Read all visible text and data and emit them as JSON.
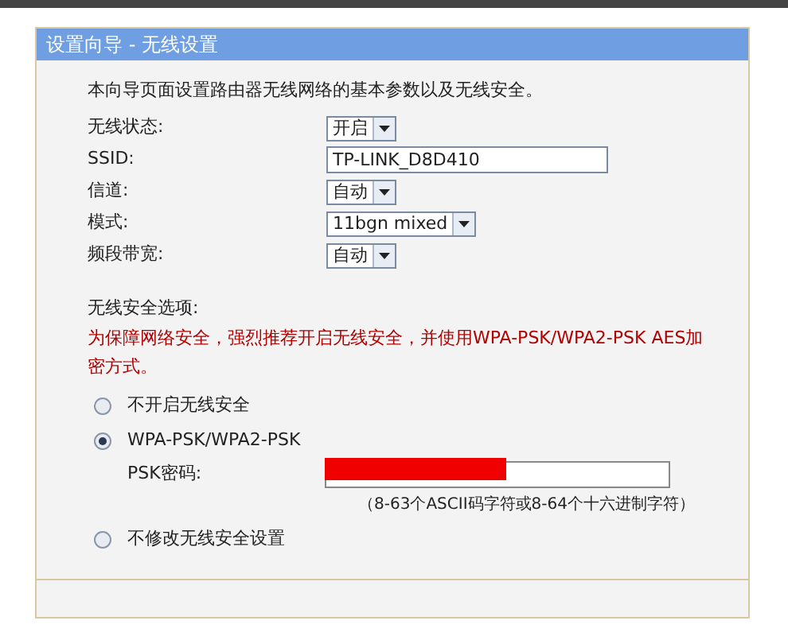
{
  "panel": {
    "title": "设置向导 - 无线设置",
    "description": "本向导页面设置路由器无线网络的基本参数以及无线安全。"
  },
  "fields": [
    {
      "kind": "select",
      "label": "无线状态:",
      "value": "开启"
    },
    {
      "kind": "text",
      "label": "SSID:",
      "value": "TP-LINK_D8D410"
    },
    {
      "kind": "select",
      "label": "信道:",
      "value": "自动"
    },
    {
      "kind": "select",
      "label": "模式:",
      "value": "11bgn mixed"
    },
    {
      "kind": "select",
      "label": "频段带宽:",
      "value": "自动"
    }
  ],
  "security": {
    "heading": "无线安全选项:",
    "warning": "为保障网络安全，强烈推荐开启无线安全，并使用WPA-PSK/WPA2-PSK AES加密方式。",
    "options": [
      {
        "label": "不开启无线安全",
        "selected": false
      },
      {
        "label": "WPA-PSK/WPA2-PSK",
        "selected": true,
        "password_label": "PSK密码:",
        "password_redacted": true,
        "hint": "（8-63个ASCII码字符或8-64个十六进制字符）"
      },
      {
        "label": "不修改无线安全设置",
        "selected": false
      }
    ]
  }
}
